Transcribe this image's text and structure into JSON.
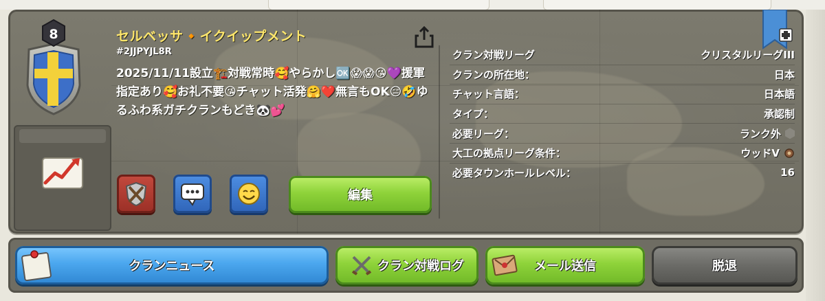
{
  "clan": {
    "level": "8",
    "name": "セルベッサ🔸イクイップメント",
    "tag": "#2JJPYJL8R",
    "description": "2025/11/11設立🏗️対戦常時🥰やらかし🆗😱😱😘💜援軍指定あり🥰お礼不要😘チャット活発🤗❤️無言もOK😑🤣ゆるふわ系ガチクランもどき🐼💕"
  },
  "actions": {
    "edit_label": "編集"
  },
  "info": [
    {
      "label": "クラン対戦リーグ",
      "value": "クリスタルリーグIII",
      "icon": ""
    },
    {
      "label": "クランの所在地：",
      "value": "日本",
      "icon": ""
    },
    {
      "label": "チャット言語：",
      "value": "日本語",
      "icon": ""
    },
    {
      "label": "タイプ：",
      "value": "承認制",
      "icon": ""
    },
    {
      "label": "必要リーグ：",
      "value": "ランク外",
      "icon": "unranked-league-icon"
    },
    {
      "label": "大工の拠点リーグ条件：",
      "value": "ウッドV",
      "icon": "wood-league-icon"
    },
    {
      "label": "必要タウンホールレベル：",
      "value": "16",
      "icon": ""
    }
  ],
  "bottom": {
    "news": "クランニュース",
    "war_log": "クラン対戦ログ",
    "mail": "メール送信",
    "leave": "脱退"
  },
  "colors": {
    "clan_name": "#ffe76b",
    "green_button": "#8fd33a",
    "blue_button": "#4ba7ee",
    "gray_button": "#6b6b67",
    "panel": "#7c7a6e"
  }
}
